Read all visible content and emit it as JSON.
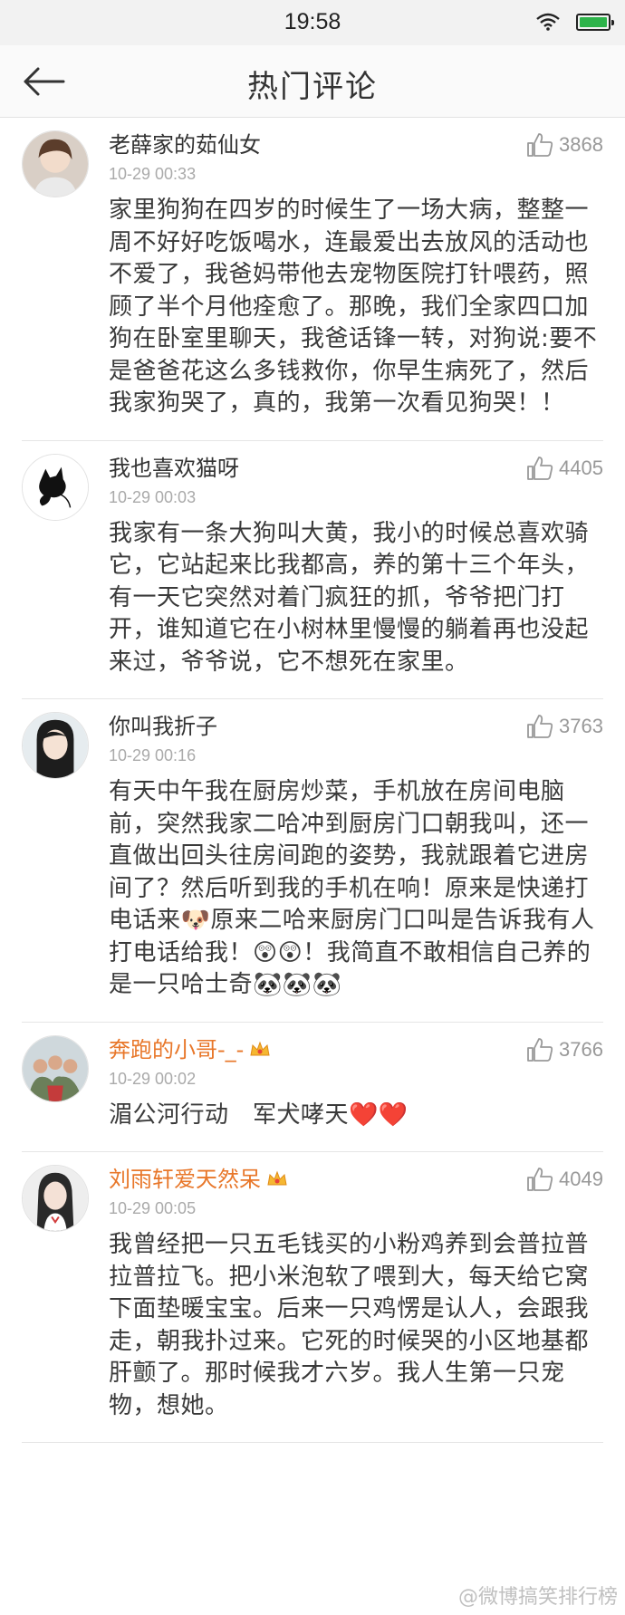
{
  "status_bar": {
    "time": "19:58"
  },
  "nav": {
    "title": "热门评论"
  },
  "comments": [
    {
      "user": "老薛家的茹仙女",
      "likes": "3868",
      "time": "10-29 00:33",
      "text": "家里狗狗在四岁的时候生了一场大病，整整一周不好好吃饭喝水，连最爱出去放风的活动也不爱了，我爸妈带他去宠物医院打针喂药，照顾了半个月他痊愈了。那晚，我们全家四口加狗在卧室里聊天，我爸话锋一转，对狗说:要不是爸爸花这么多钱救你，你早生病死了，然后我家狗哭了，真的，我第一次看见狗哭！！"
    },
    {
      "user": "我也喜欢猫呀",
      "likes": "4405",
      "time": "10-29 00:03",
      "text": "我家有一条大狗叫大黄，我小的时候总喜欢骑它，它站起来比我都高，养的第十三个年头，有一天它突然对着门疯狂的抓，爷爷把门打开，谁知道它在小树林里慢慢的躺着再也没起来过，爷爷说，它不想死在家里。"
    },
    {
      "user": "你叫我折子",
      "likes": "3763",
      "time": "10-29 00:16",
      "text": "有天中午我在厨房炒菜，手机放在房间电脑前，突然我家二哈冲到厨房门口朝我叫，还一直做出回头往房间跑的姿势，我就跟着它进房间了？然后听到我的手机在响！原来是快递打电话来🐶原来二哈来厨房门口叫是告诉我有人打电话给我！😲😲！我简直不敢相信自己养的是一只哈士奇🐼🐼🐼"
    },
    {
      "user": "奔跑的小哥-_-",
      "likes": "3766",
      "time": "10-29 00:02",
      "text": "湄公河行动　军犬哮天❤️❤️"
    },
    {
      "user": "刘雨轩爱天然呆",
      "likes": "4049",
      "time": "10-29 00:05",
      "text": "我曾经把一只五毛钱买的小粉鸡养到会普拉普拉普拉飞。把小米泡软了喂到大，每天给它窝下面垫暖宝宝。后来一只鸡愣是认人，会跟我走，朝我扑过来。它死的时候哭的小区地基都肝颤了。那时候我才六岁。我人生第一只宠物，想她。"
    }
  ],
  "watermark": "@微博搞笑排行榜",
  "colors": {
    "vip_name": "#e8772a",
    "meta": "#aaaaaa",
    "divider": "#e6e6e6"
  }
}
